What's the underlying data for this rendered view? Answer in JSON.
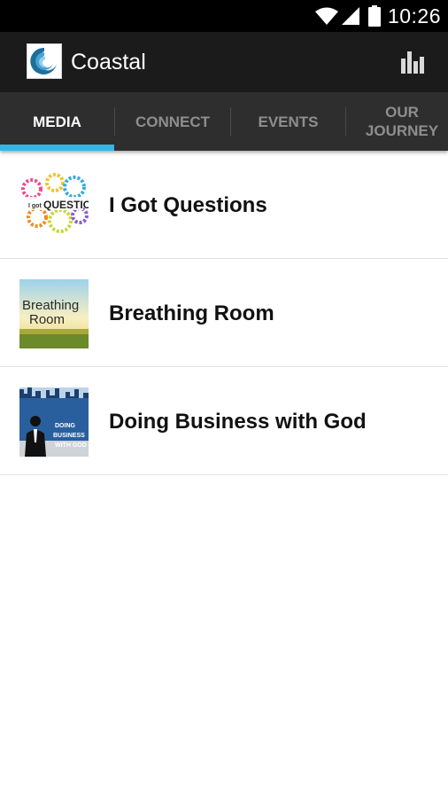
{
  "status_bar": {
    "time": "10:26",
    "icons": [
      "wifi-icon",
      "signal-icon",
      "battery-icon"
    ]
  },
  "action_bar": {
    "title": "Coastal",
    "logo": "coastal-wave-logo",
    "action_icon": "stats-icon"
  },
  "tabs": [
    {
      "label": "MEDIA",
      "active": true
    },
    {
      "label": "CONNECT",
      "active": false
    },
    {
      "label": "EVENTS",
      "active": false
    },
    {
      "label": "OUR JOURNEY",
      "active": false
    }
  ],
  "media_list": [
    {
      "title": "I Got Questions",
      "thumb_text": "QUESTIONS"
    },
    {
      "title": "Breathing Room",
      "thumb_text": "Breathing Room"
    },
    {
      "title": "Doing Business with God",
      "thumb_text": "DOING BUSINESS WITH GOD"
    }
  ],
  "colors": {
    "status_bar": "#000000",
    "action_bar": "#1b1b1b",
    "tab_bar": "#2e2e2e",
    "tab_indicator": "#33b5e5",
    "active_tab_text": "#ffffff",
    "inactive_tab_text": "#8e8e8e"
  }
}
